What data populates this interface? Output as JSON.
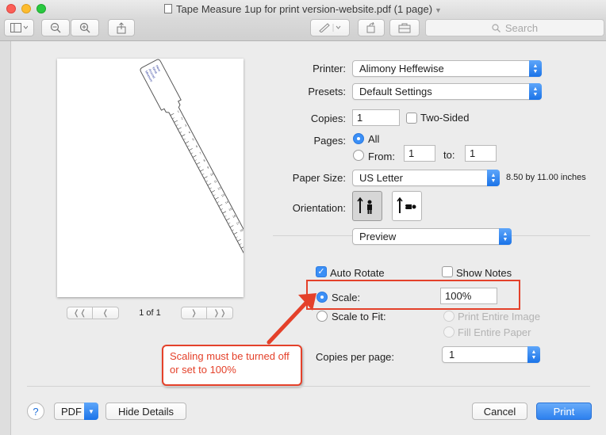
{
  "window": {
    "title": "Tape Measure 1up for print version-website.pdf (1 page)",
    "search_placeholder": "Search"
  },
  "preview": {
    "page_indicator": "1 of 1",
    "ruler_label_lines": [
      "Measure",
      "Around",
      "Wrist",
      "Here"
    ],
    "ruler_ticks": [
      "1",
      "2",
      "3",
      "4",
      "5",
      "6",
      "7",
      "8",
      "9",
      "10",
      "11",
      "12",
      "13",
      "14",
      "15",
      "16",
      "17",
      "18",
      "19",
      "20"
    ]
  },
  "form": {
    "printer_label": "Printer:",
    "printer_value": "Alimony Heffewise",
    "presets_label": "Presets:",
    "presets_value": "Default Settings",
    "copies_label": "Copies:",
    "copies_value": "1",
    "two_sided_label": "Two-Sided",
    "pages_label": "Pages:",
    "pages_all_label": "All",
    "pages_from_label": "From:",
    "pages_from_value": "1",
    "pages_to_label": "to:",
    "pages_to_value": "1",
    "paper_size_label": "Paper Size:",
    "paper_size_value": "US Letter",
    "paper_size_dims": "8.50 by 11.00 inches",
    "orientation_label": "Orientation:",
    "section_value": "Preview",
    "auto_rotate_label": "Auto Rotate",
    "show_notes_label": "Show Notes",
    "scale_label": "Scale:",
    "scale_value": "100%",
    "scale_to_fit_label": "Scale to Fit:",
    "print_entire_image_label": "Print Entire Image",
    "fill_entire_paper_label": "Fill Entire Paper",
    "copies_per_page_label": "Copies per page:",
    "copies_per_page_value": "1"
  },
  "annotation": {
    "callout_text": "Scaling must be turned off or set to 100%",
    "color": "#e4412a"
  },
  "buttons": {
    "help": "?",
    "pdf": "PDF",
    "hide_details": "Hide Details",
    "cancel": "Cancel",
    "print": "Print"
  },
  "colors": {
    "accent": "#3b8ff6",
    "annotation": "#e4412a"
  }
}
